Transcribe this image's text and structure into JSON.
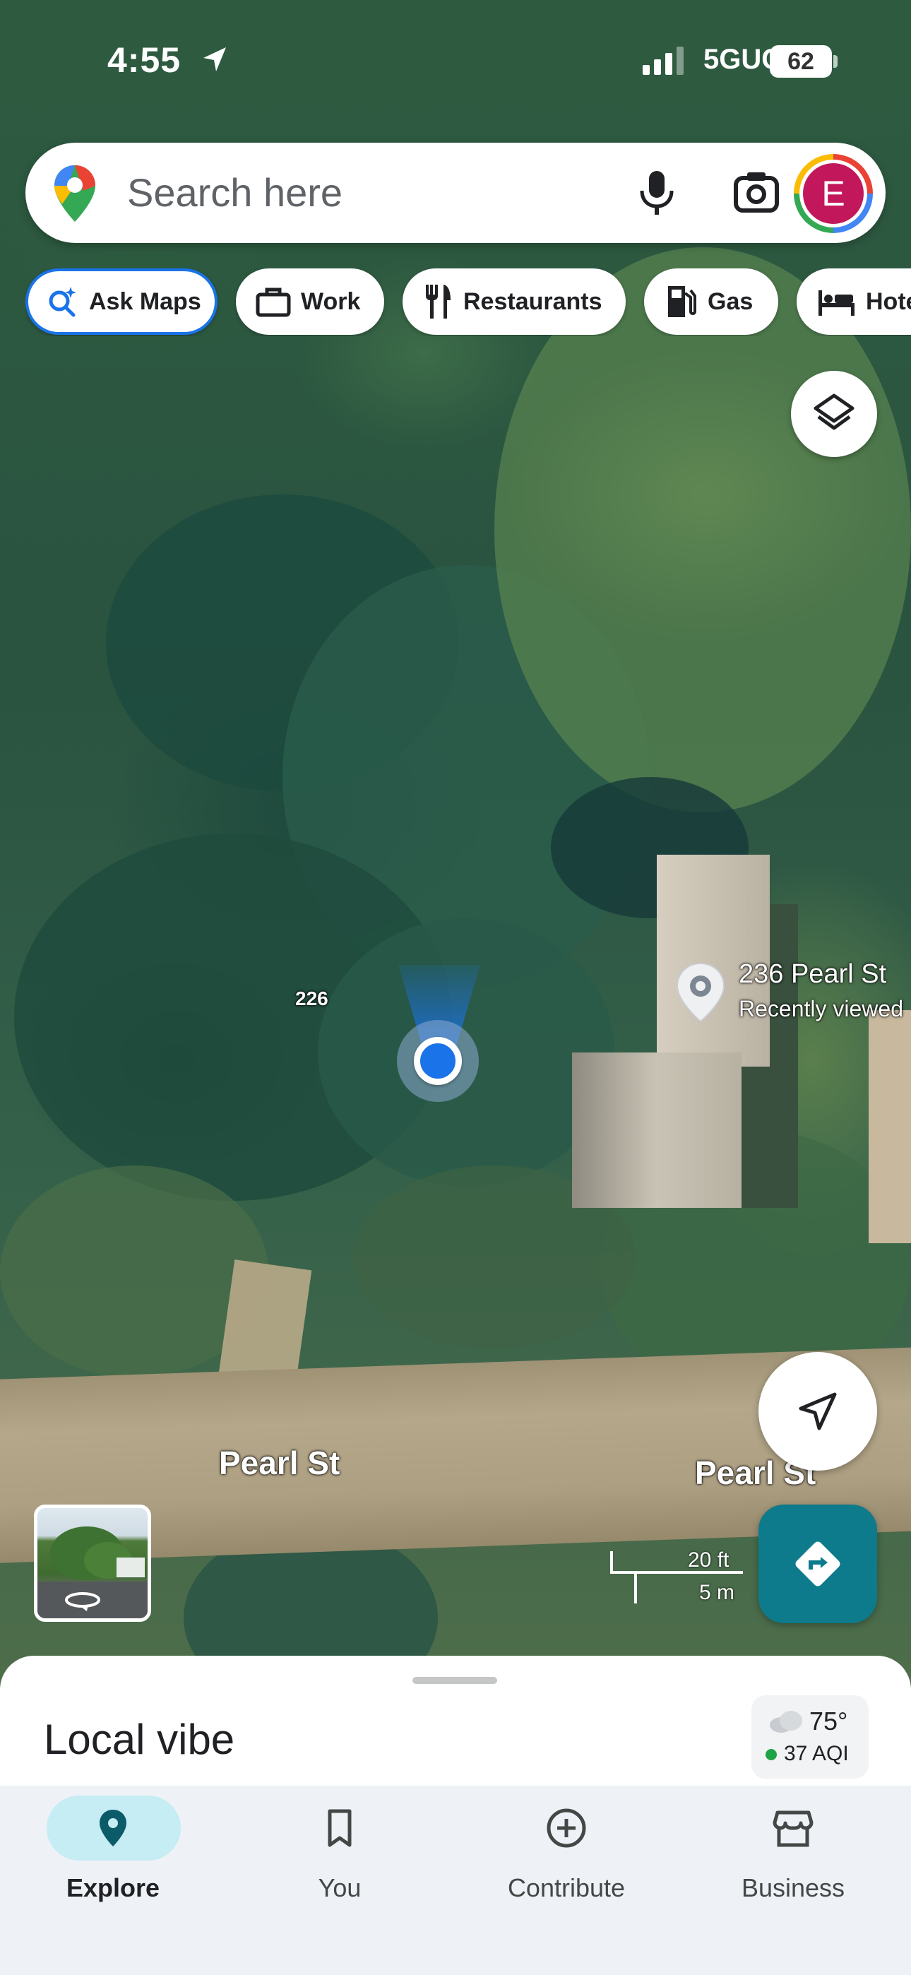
{
  "status_bar": {
    "time": "4:55",
    "network": "5GUC",
    "battery": "62"
  },
  "search": {
    "placeholder": "Search here",
    "avatar_letter": "E"
  },
  "chips": [
    {
      "label": "Ask Maps",
      "icon": "sparkle-search-icon"
    },
    {
      "label": "Work",
      "icon": "briefcase-icon"
    },
    {
      "label": "Restaurants",
      "icon": "fork-knife-icon"
    },
    {
      "label": "Gas",
      "icon": "gas-pump-icon"
    },
    {
      "label": "Hote",
      "icon": "bed-icon"
    }
  ],
  "map": {
    "street_labels": [
      "Pearl St",
      "Pearl St"
    ],
    "house_number": "226",
    "place": {
      "name": "236 Pearl St",
      "subtitle": "Recently viewed"
    },
    "scale": {
      "feet": "20 ft",
      "meters": "5 m"
    }
  },
  "sheet": {
    "title": "Local vibe",
    "weather": {
      "temp": "75°",
      "aqi": "37 AQI"
    }
  },
  "nav": [
    {
      "label": "Explore",
      "icon": "explore-pin-icon",
      "active": true
    },
    {
      "label": "You",
      "icon": "bookmark-icon",
      "active": false
    },
    {
      "label": "Contribute",
      "icon": "add-circle-icon",
      "active": false
    },
    {
      "label": "Business",
      "icon": "storefront-icon",
      "active": false
    }
  ],
  "colors": {
    "accent": "#1a73e8",
    "directions": "#0d7b8b",
    "nav_active": "#c6ecf4"
  }
}
